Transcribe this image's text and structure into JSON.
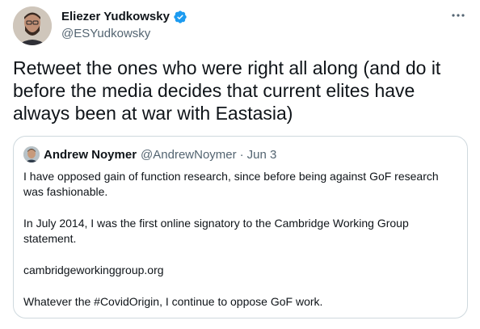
{
  "author": {
    "display_name": "Eliezer Yudkowsky",
    "handle": "@ESYudkowsky",
    "avatar_icon": "person-avatar",
    "verified_icon": "verified-badge-icon"
  },
  "tweet": {
    "text": "Retweet the ones who were right all along (and do it before the media decides that current elites have always been at war with Eastasia)"
  },
  "quoted_tweet": {
    "display_name": "Andrew Noymer",
    "handle": "@AndrewNoymer",
    "separator": "·",
    "date": "Jun 3",
    "paragraphs": [
      "I have opposed gain of function research, since before being against GoF research was fashionable.",
      "In July 2014, I was the first online signatory to the Cambridge Working Group statement.",
      "cambridgeworkinggroup.org",
      "Whatever the #CovidOrigin, I continue to oppose GoF work."
    ]
  },
  "colors": {
    "text": "#0f1419",
    "secondary": "#536471",
    "border": "#cfd9de",
    "verified": "#1d9bf0"
  }
}
